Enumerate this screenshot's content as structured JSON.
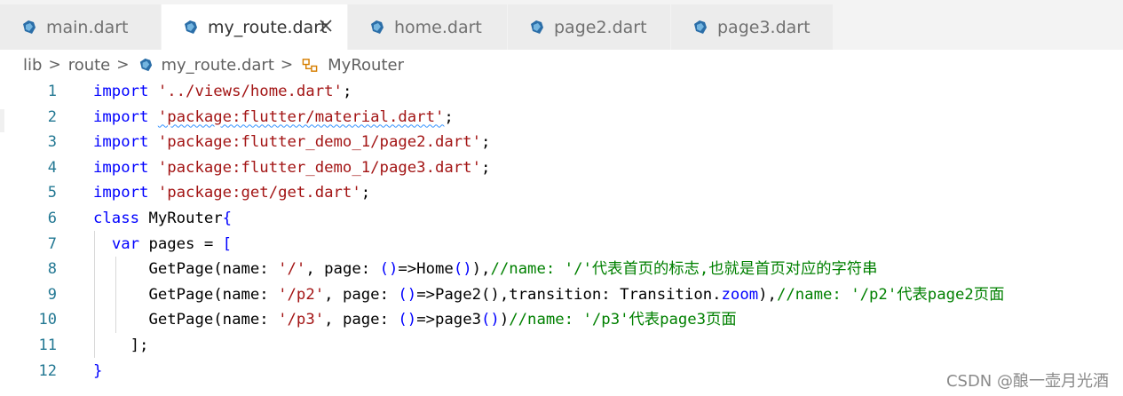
{
  "tabs": [
    {
      "label": "main.dart",
      "active": false
    },
    {
      "label": "my_route.dart",
      "active": true
    },
    {
      "label": "home.dart",
      "active": false
    },
    {
      "label": "page2.dart",
      "active": false
    },
    {
      "label": "page3.dart",
      "active": false
    }
  ],
  "breadcrumb": {
    "folder1": "lib",
    "folder2": "route",
    "file": "my_route.dart",
    "symbol": "MyRouter"
  },
  "editor": {
    "line_numbers": [
      "1",
      "2",
      "3",
      "4",
      "5",
      "6",
      "7",
      "8",
      "9",
      "10",
      "11",
      "12"
    ],
    "lines": {
      "l1": {
        "kw": "import",
        "str": "'../views/home.dart'",
        "end": ";"
      },
      "l2": {
        "kw": "import",
        "str": "'package:flutter/material.dart'",
        "end": ";"
      },
      "l3": {
        "kw": "import",
        "str": "'package:flutter_demo_1/page2.dart'",
        "end": ";"
      },
      "l4": {
        "kw": "import",
        "str": "'package:flutter_demo_1/page3.dart'",
        "end": ";"
      },
      "l5": {
        "kw": "import",
        "str": "'package:get/get.dart'",
        "end": ";"
      },
      "l6": {
        "kw": "class",
        "name": "MyRouter",
        "brace": "{"
      },
      "l7": {
        "kw": "var",
        "rest": "pages = ",
        "bracket": "["
      },
      "l8": {
        "a": "GetPage(name: ",
        "s1": "'/'",
        "b": ", page: ",
        "p1": "()",
        "c": "=>Home",
        "p2": "()",
        "d": "),",
        "comment": "//name: '/'代表首页的标志,也就是首页对应的字符串"
      },
      "l9": {
        "a": "GetPage(name: ",
        "s1": "'/p2'",
        "b": ", page: ",
        "p1": "()",
        "c": "=>Page2(),transition: Transition.",
        "zoom": "zoom",
        "d": "),",
        "comment": "//name: '/p2'代表page2页面"
      },
      "l10": {
        "a": "GetPage(name: ",
        "s1": "'/p3'",
        "b": ", page: ",
        "p1": "()",
        "c": "=>page3",
        "p2": "()",
        "d": ")",
        "comment": "//name: '/p3'代表page3页面"
      },
      "l11": {
        "text": "];"
      },
      "l12": {
        "text": "}"
      }
    }
  },
  "watermark": "CSDN @酿一壶月光酒",
  "colors": {
    "keyword": "#0000ff",
    "string": "#a31515",
    "comment": "#008000",
    "line_number": "#237893"
  }
}
